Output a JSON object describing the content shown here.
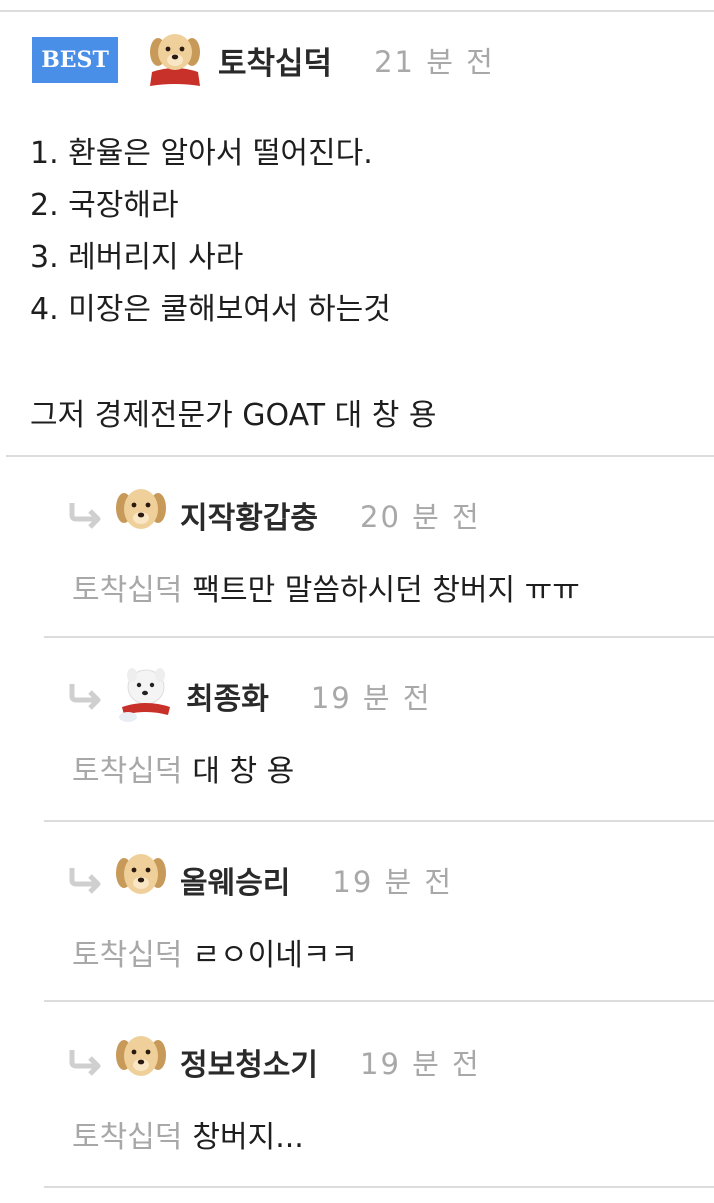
{
  "best_comment": {
    "badge": "BEST",
    "author": "토착십덕",
    "time": "21 분 전",
    "avatar_icon": "puppy-scarf-icon",
    "lines": [
      "1. 환율은 알아서 떨어진다.",
      "2. 국장해라",
      "3. 레버리지 사라",
      "4. 미장은 쿨해보여서 하는것",
      "그저 경제전문가 GOAT 대 창 용"
    ]
  },
  "replies": [
    {
      "author": "지작황갑충",
      "time": "20 분 전",
      "mention": "토착십덕",
      "text": "팩트만 말씀하시던 창버지 ㅠㅠ",
      "avatar_icon": "puppy-icon"
    },
    {
      "author": "최종화",
      "time": "19 분 전",
      "mention": "토착십덕",
      "text": "대 창 용",
      "avatar_icon": "white-dog-icon"
    },
    {
      "author": "올웨승리",
      "time": "19 분 전",
      "mention": "토착십덕",
      "text": "ㄹㅇ이네ㅋㅋ",
      "avatar_icon": "puppy-icon"
    },
    {
      "author": "정보청소기",
      "time": "19 분 전",
      "mention": "토착십덕",
      "text": "창버지...",
      "avatar_icon": "puppy-icon"
    }
  ],
  "colors": {
    "badge": "#4a8fe7",
    "muted": "#a8a8a8",
    "divider": "#dcdcdc"
  }
}
